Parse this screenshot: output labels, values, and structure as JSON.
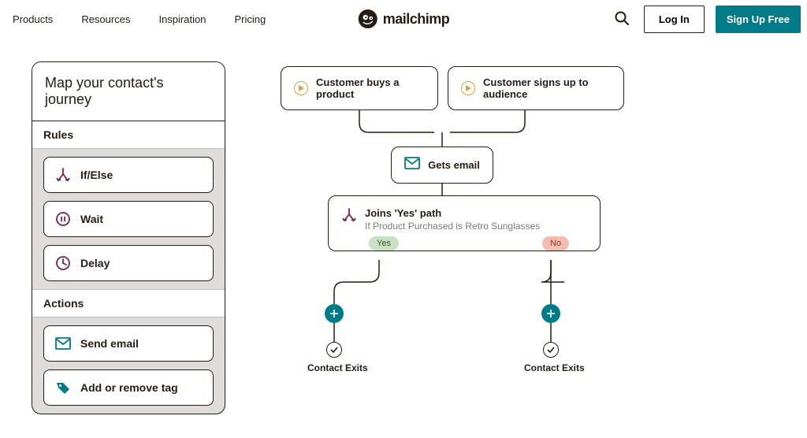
{
  "nav": {
    "items": [
      "Products",
      "Resources",
      "Inspiration",
      "Pricing"
    ]
  },
  "brand": {
    "name": "mailchimp"
  },
  "header": {
    "login": "Log In",
    "signup": "Sign Up Free"
  },
  "panel": {
    "title": "Map your contact's journey",
    "rules_header": "Rules",
    "actions_header": "Actions",
    "rules": [
      {
        "label": "If/Else",
        "icon": "branch-icon"
      },
      {
        "label": "Wait",
        "icon": "pause-icon"
      },
      {
        "label": "Delay",
        "icon": "clock-icon"
      }
    ],
    "actions": [
      {
        "label": "Send email",
        "icon": "mail-icon"
      },
      {
        "label": "Add or remove tag",
        "icon": "tag-icon"
      }
    ]
  },
  "diagram": {
    "trigger1": "Customer buys a product",
    "trigger2": "Customer signs up to audience",
    "step_email": "Gets email",
    "branch_title": "Joins 'Yes' path",
    "branch_sub": "If Product Purchased is Retro Sunglasses",
    "yes": "Yes",
    "no": "No",
    "exit": "Contact Exits"
  },
  "colors": {
    "accent": "#007c89",
    "burgundy": "#7d2248",
    "gold": "#d9a441"
  }
}
